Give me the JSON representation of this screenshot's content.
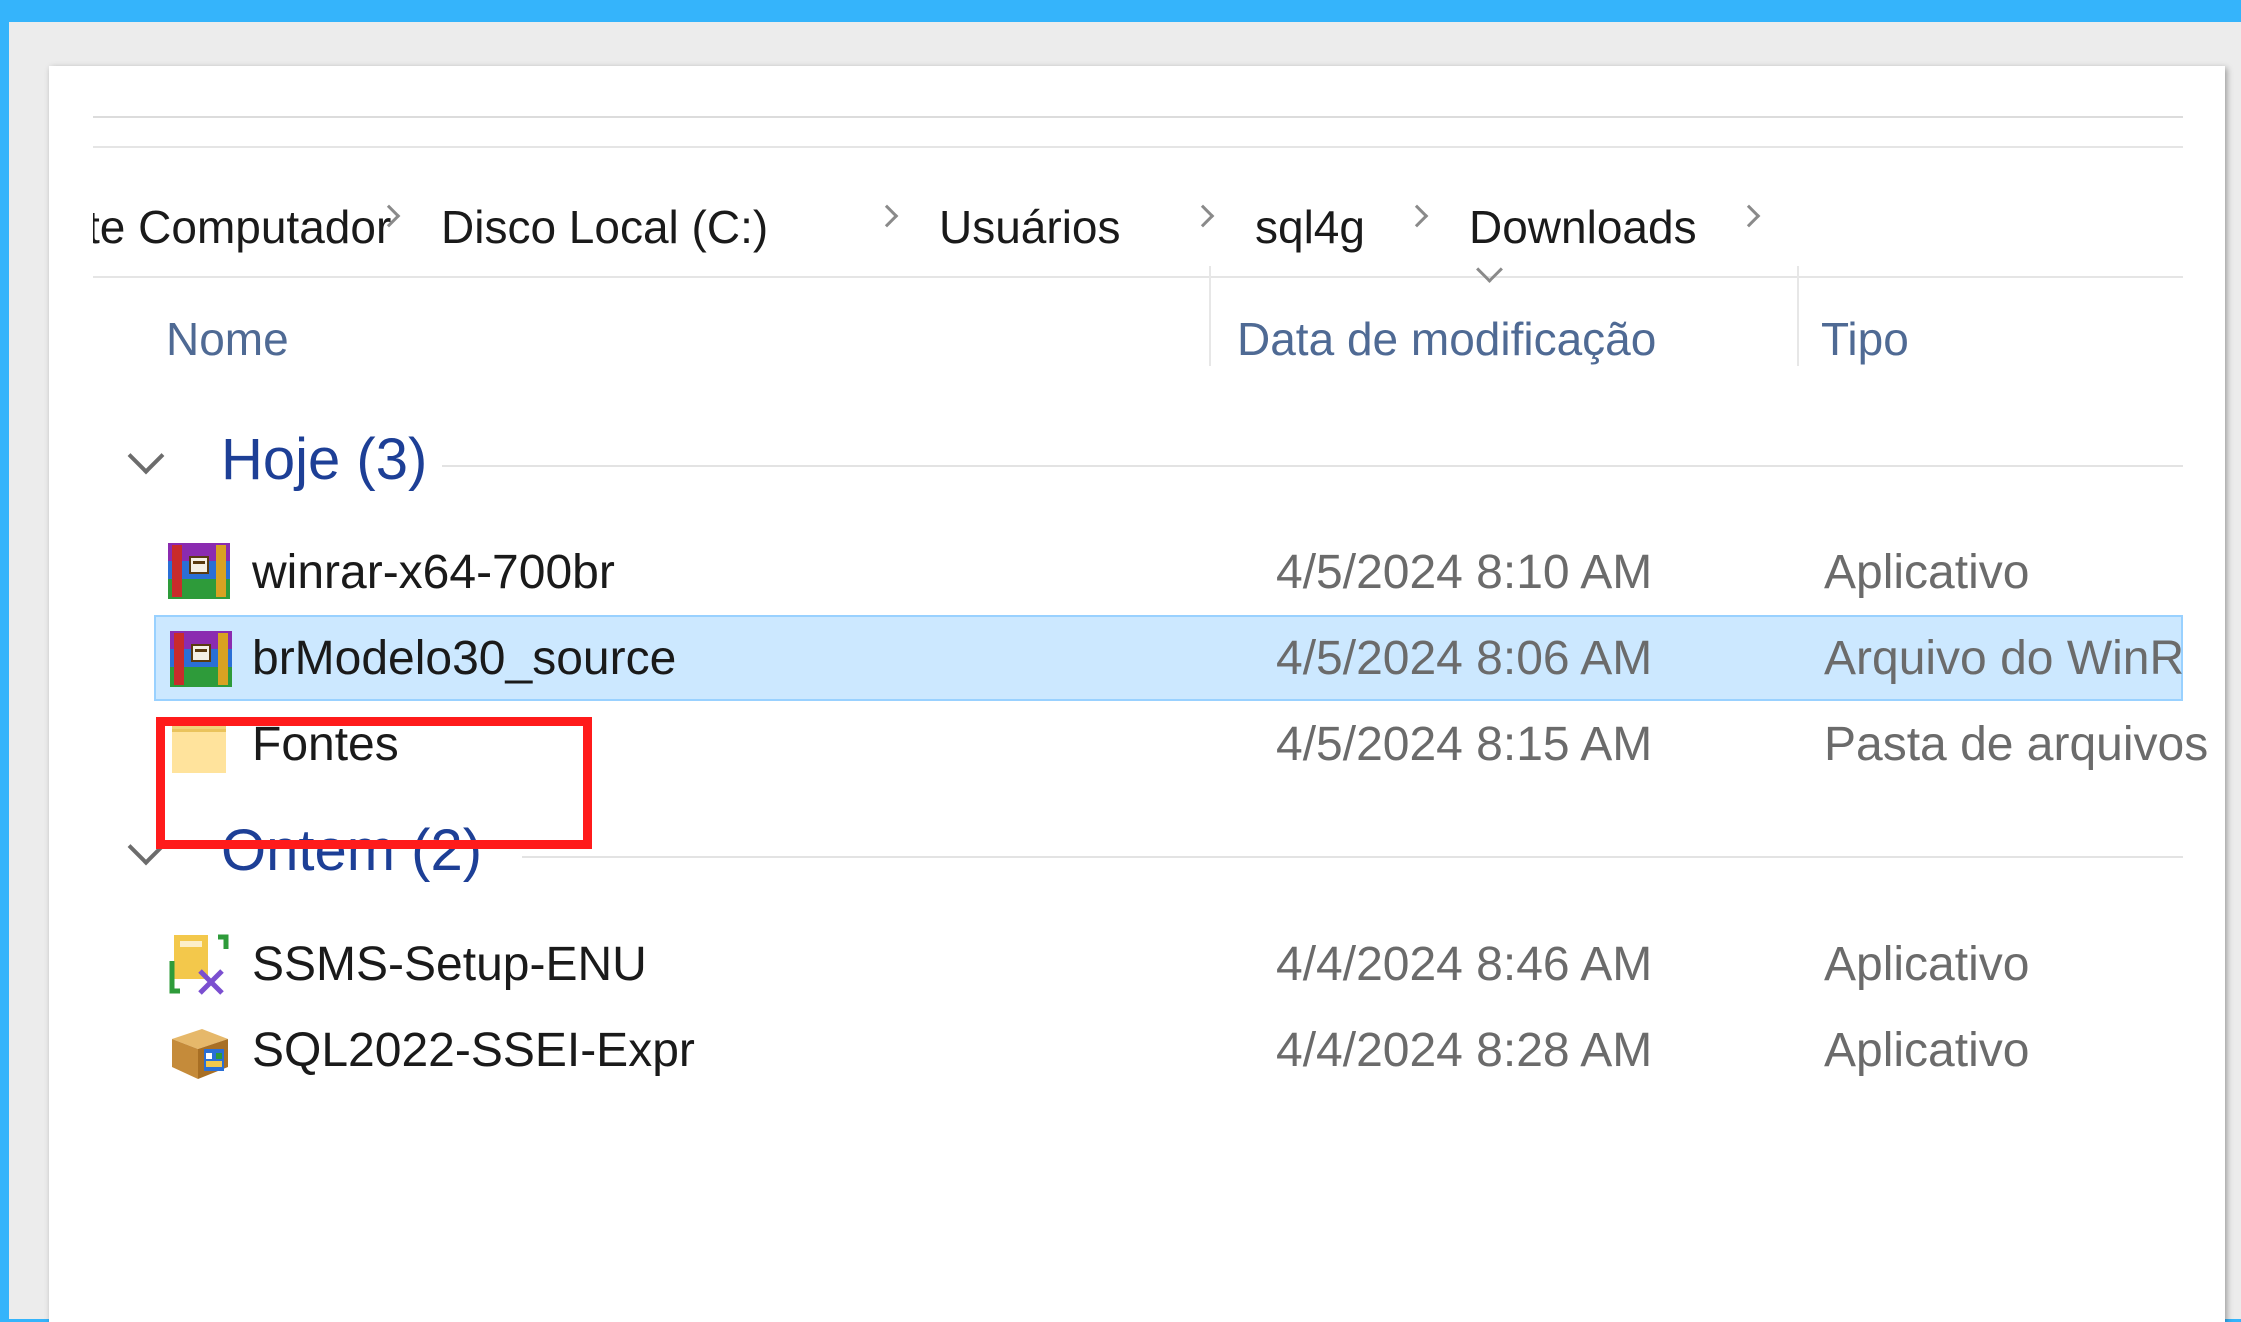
{
  "breadcrumb": {
    "items": [
      "te Computador",
      "Disco Local (C:)",
      "Usuários",
      "sql4g",
      "Downloads"
    ]
  },
  "columns": {
    "name": "Nome",
    "date": "Data de modificação",
    "type": "Tipo"
  },
  "groups": [
    {
      "label": "Hoje (3)",
      "files": [
        {
          "name": "winrar-x64-700br",
          "date": "4/5/2024 8:10 AM",
          "type": "Aplicativo",
          "icon": "winrar-icon",
          "selected": false
        },
        {
          "name": "brModelo30_source",
          "date": "4/5/2024 8:06 AM",
          "type": "Arquivo do WinR",
          "icon": "winrar-archive-icon",
          "selected": true
        },
        {
          "name": "Fontes",
          "date": "4/5/2024 8:15 AM",
          "type": "Pasta de arquivos",
          "icon": "folder-icon",
          "selected": false
        }
      ]
    },
    {
      "label": "Ontem (2)",
      "files": [
        {
          "name": "SSMS-Setup-ENU",
          "date": "4/4/2024 8:46 AM",
          "type": "Aplicativo",
          "icon": "ssms-installer-icon",
          "selected": false
        },
        {
          "name": "SQL2022-SSEI-Expr",
          "date": "4/4/2024 8:28 AM",
          "type": "Aplicativo",
          "icon": "sql-installer-icon",
          "selected": false
        }
      ]
    }
  ],
  "colors": {
    "background": "#35b4fb",
    "selection": "#cce8ff",
    "group_label": "#1d3f96",
    "highlight_box": "#ff1b1b"
  }
}
